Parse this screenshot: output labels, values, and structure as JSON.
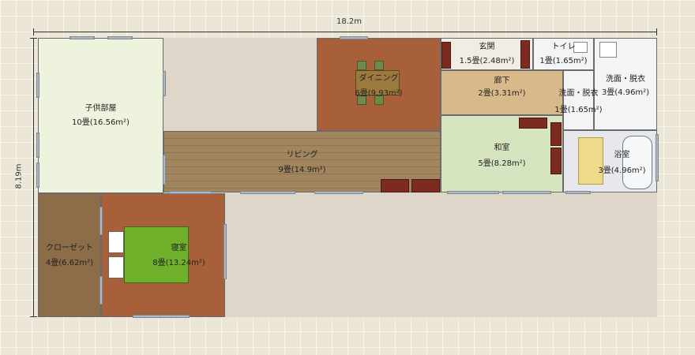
{
  "dimensions": {
    "width_label": "18.2m",
    "height_label": "8.19m"
  },
  "rooms": {
    "kids": {
      "name": "子供部屋",
      "size": "10畳(16.56m²)"
    },
    "dining": {
      "name": "ダイニング",
      "size": "6畳(9.93m²)"
    },
    "entrance": {
      "name": "玄関",
      "size": "1.5畳(2.48m²)"
    },
    "toilet": {
      "name": "トイレ",
      "size": "1畳(1.65m²)"
    },
    "hall": {
      "name": "廊下",
      "size": "2畳(3.31m²)"
    },
    "wash1": {
      "name": "洗面・脱衣",
      "size": "1畳(1.65m²)"
    },
    "wash2": {
      "name": "洗面・脱衣",
      "size": "3畳(4.96m²)"
    },
    "living": {
      "name": "リビング",
      "size": "9畳(14.9m²)"
    },
    "washitsu": {
      "name": "和室",
      "size": "5畳(8.28m²)"
    },
    "bath": {
      "name": "浴室",
      "size": "3畳(4.96m²)"
    },
    "closet": {
      "name": "クローゼット",
      "size": "4畳(6.62m²)"
    },
    "bedroom": {
      "name": "寝室",
      "size": "8畳(13.24m²)"
    }
  },
  "colors": {
    "floor_wood": "#a0855f",
    "dining_floor": "#a8603a",
    "tatami": "#d7e4c0",
    "tile": "#e6e8ec",
    "closet_floor": "#8c6d47",
    "bed_cover": "#6fb12a",
    "furniture": "#7d2a20"
  }
}
